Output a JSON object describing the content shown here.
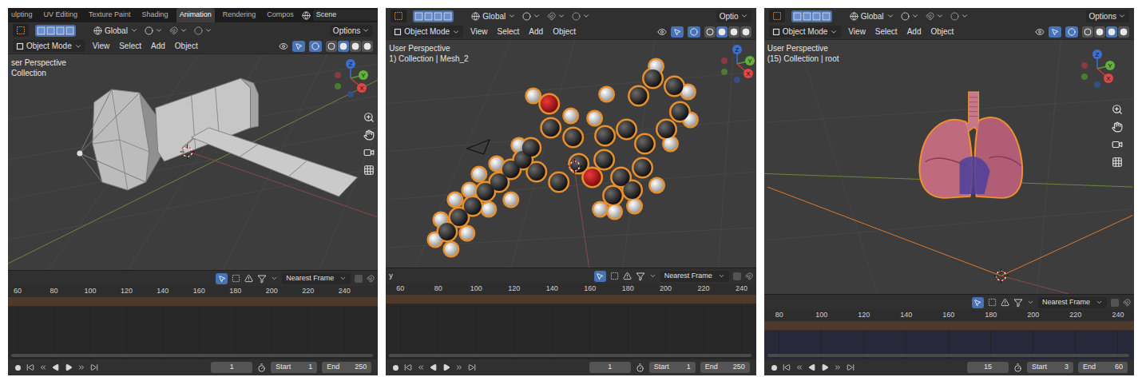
{
  "panels": [
    {
      "scene": {
        "kind": "satellite"
      },
      "workspace_tabs": [
        {
          "label": "ulpting",
          "selected": false
        },
        {
          "label": "UV Editing",
          "selected": false
        },
        {
          "label": "Texture Paint",
          "selected": false
        },
        {
          "label": "Shading",
          "selected": false
        },
        {
          "label": "Animation",
          "selected": true
        },
        {
          "label": "Rendering",
          "selected": false
        },
        {
          "label": "Compos",
          "selected": false
        }
      ],
      "scene_field": "Scene",
      "toolbar": {
        "orientation": "Global",
        "options": "Options"
      },
      "menu": {
        "mode": "Object Mode",
        "items": [
          "View",
          "Select",
          "Add",
          "Object"
        ]
      },
      "shading": [
        {
          "selected": false
        },
        {
          "selected": true
        },
        {
          "selected": false
        },
        {
          "selected": false
        }
      ],
      "viewport": {
        "perspective": "ser Perspective",
        "collection": "Collection"
      },
      "gizmo": {
        "x": "X",
        "y": "Y",
        "z": "Z"
      },
      "timeline": {
        "snap": "Nearest Frame",
        "ticks": [
          "60",
          "80",
          "100",
          "120",
          "140",
          "160",
          "180",
          "200",
          "220",
          "240"
        ],
        "current_frame": "1",
        "start_label": "Start",
        "start": "1",
        "end_label": "End",
        "end": "250"
      }
    },
    {
      "scene": {
        "kind": "molecule"
      },
      "toolbar": {
        "orientation": "Global",
        "options": "Optio"
      },
      "menu": {
        "mode": "Object Mode",
        "items": [
          "View",
          "Select",
          "Add",
          "Object"
        ]
      },
      "shading": [
        {
          "selected": false
        },
        {
          "selected": true
        },
        {
          "selected": false
        },
        {
          "selected": false
        }
      ],
      "viewport": {
        "perspective": "User Perspective",
        "collection": "1) Collection | Mesh_2"
      },
      "gizmo": {
        "x": "X",
        "y": "Y",
        "z": "Z"
      },
      "timeline": {
        "label": "y",
        "snap": "Nearest Frame",
        "ticks": [
          "60",
          "80",
          "100",
          "120",
          "140",
          "160",
          "180",
          "200",
          "220",
          "240"
        ],
        "current_frame": "1",
        "start_label": "Start",
        "start": "1",
        "end_label": "End",
        "end": "250"
      }
    },
    {
      "scene": {
        "kind": "lungs"
      },
      "toolbar": {
        "orientation": "Global",
        "options": "Options"
      },
      "menu": {
        "mode": "Object Mode",
        "items": [
          "View",
          "Select",
          "Add",
          "Object"
        ]
      },
      "shading": [
        {
          "selected": false
        },
        {
          "selected": false
        },
        {
          "selected": true
        },
        {
          "selected": false
        }
      ],
      "viewport": {
        "perspective": "User Perspective",
        "collection": "(15) Collection | root"
      },
      "gizmo": {
        "x": "X",
        "y": "Y",
        "z": "Z"
      },
      "timeline": {
        "snap": "Nearest Frame",
        "ticks": [
          "80",
          "100",
          "120",
          "140",
          "160",
          "180",
          "200",
          "220",
          "240"
        ],
        "current_frame": "15",
        "start_label": "Start",
        "start": "3",
        "end_label": "End",
        "end": "60"
      }
    }
  ]
}
